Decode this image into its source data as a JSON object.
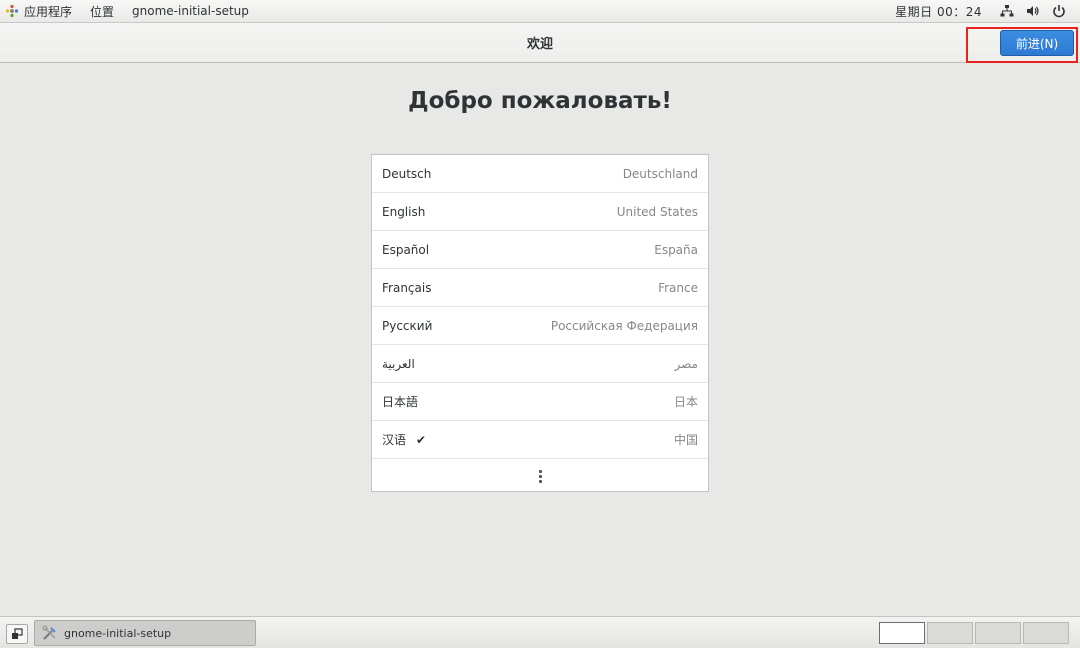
{
  "top_panel": {
    "applications_label": "应用程序",
    "places_label": "位置",
    "window_label": "gnome-initial-setup",
    "clock": "星期日 00：24",
    "icons": [
      "network-icon",
      "volume-icon",
      "power-icon"
    ]
  },
  "header": {
    "title": "欢迎",
    "next_label": "前进(N)",
    "accent": "#3584e4",
    "highlight_color": "#e8221f"
  },
  "main": {
    "welcome_title": "Добро пожаловать!",
    "languages": [
      {
        "name": "Deutsch",
        "region": "Deutschland",
        "selected": false
      },
      {
        "name": "English",
        "region": "United States",
        "selected": false
      },
      {
        "name": "Español",
        "region": "España",
        "selected": false
      },
      {
        "name": "Français",
        "region": "France",
        "selected": false
      },
      {
        "name": "Русский",
        "region": "Российская Федерация",
        "selected": false
      },
      {
        "name": "العربية",
        "region": "مصر",
        "selected": false
      },
      {
        "name": "日本語",
        "region": "日本",
        "selected": false
      },
      {
        "name": "汉语",
        "region": "中国",
        "selected": true,
        "check": "✔"
      }
    ],
    "more_icon": "view-more-icon"
  },
  "bottom_panel": {
    "task_label": "gnome-initial-setup",
    "workspace_count": 4,
    "active_workspace": 1
  }
}
